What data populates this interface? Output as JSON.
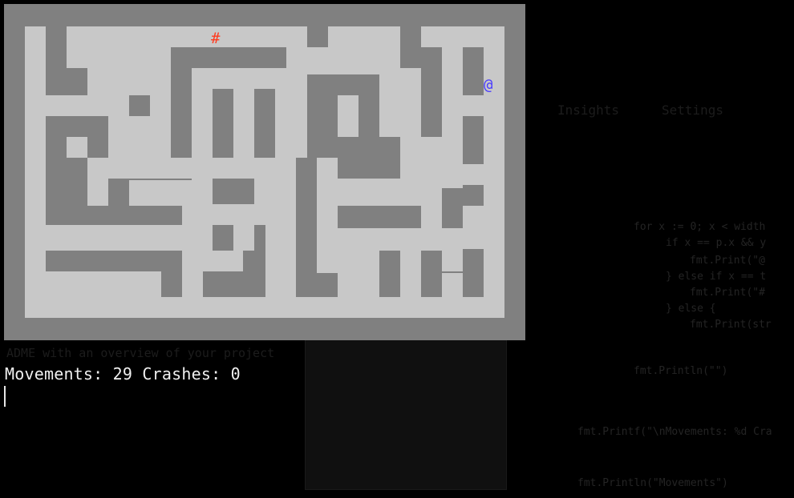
{
  "game": {
    "goal_glyph": "#",
    "player_glyph": "@",
    "goal_color": "#ff3b1f",
    "player_color": "#4a3cff",
    "wall_color": "#808080",
    "floor_color": "#c8c8c8"
  },
  "status": {
    "movements_label": "Movements:",
    "movements": "29",
    "crashes_label": "Crashes:",
    "crashes": "0"
  }
}
